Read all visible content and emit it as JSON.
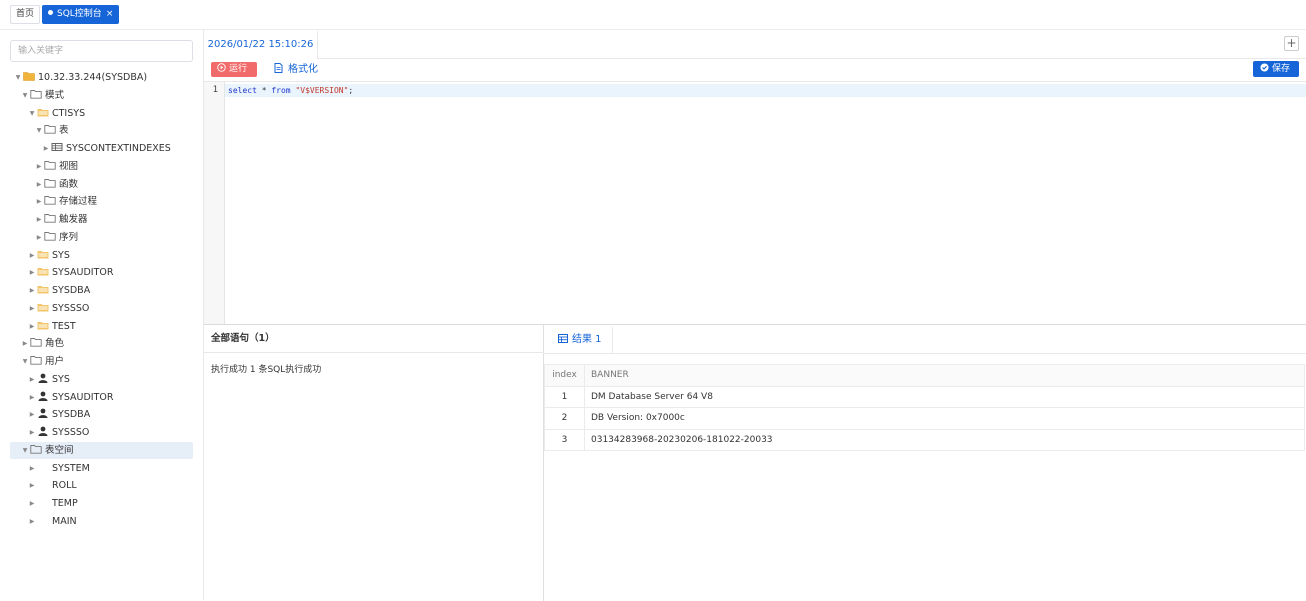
{
  "top_tabs": [
    {
      "label": "首页"
    },
    {
      "label": "SQL控制台",
      "close": "×"
    }
  ],
  "sidebar": {
    "search_placeholder": "输入关键字",
    "tree": [
      {
        "label": "10.32.33.244(SYSDBA)",
        "icon": "db-folder-icon"
      },
      {
        "label": "模式",
        "icon": "folder-icon"
      },
      {
        "label": "CTISYS",
        "icon": "schema-icon"
      },
      {
        "label": "表",
        "icon": "folder-icon"
      },
      {
        "label": "SYSCONTEXTINDEXES",
        "icon": "table-icon"
      },
      {
        "label": "视图",
        "icon": "folder-icon"
      },
      {
        "label": "函数",
        "icon": "folder-icon"
      },
      {
        "label": "存储过程",
        "icon": "folder-icon"
      },
      {
        "label": "触发器",
        "icon": "folder-icon"
      },
      {
        "label": "序列",
        "icon": "folder-icon"
      },
      {
        "label": "SYS",
        "icon": "schema-icon"
      },
      {
        "label": "SYSAUDITOR",
        "icon": "schema-icon"
      },
      {
        "label": "SYSDBA",
        "icon": "schema-icon"
      },
      {
        "label": "SYSSSO",
        "icon": "schema-icon"
      },
      {
        "label": "TEST",
        "icon": "schema-icon"
      },
      {
        "label": "角色",
        "icon": "folder-icon"
      },
      {
        "label": "用户",
        "icon": "folder-icon"
      },
      {
        "label": "SYS",
        "icon": "user-icon"
      },
      {
        "label": "SYSAUDITOR",
        "icon": "user-icon"
      },
      {
        "label": "SYSDBA",
        "icon": "user-icon"
      },
      {
        "label": "SYSSSO",
        "icon": "user-icon"
      },
      {
        "label": "表空间",
        "icon": "folder-icon"
      },
      {
        "label": "SYSTEM"
      },
      {
        "label": "ROLL"
      },
      {
        "label": "TEMP"
      },
      {
        "label": "MAIN"
      }
    ]
  },
  "editor": {
    "tab_label": "2026/01/22 15:10:26",
    "add_tab": "+",
    "run_label": "运行",
    "format_label": "格式化",
    "save_label": "保存",
    "line_number": "1",
    "code": {
      "kw1": "select",
      "star": " * ",
      "kw2": "from",
      "str": " \"V$VERSION\"",
      "end": ";"
    }
  },
  "statements": {
    "header": "全部语句（1）",
    "message": "执行成功 1 条SQL执行成功"
  },
  "results": {
    "tab_label": "结果 1",
    "columns": [
      "index",
      "BANNER"
    ],
    "rows": [
      [
        "1",
        "DM Database Server 64 V8"
      ],
      [
        "2",
        "DB Version: 0x7000c"
      ],
      [
        "3",
        "03134283968-20230206-181022-20033"
      ]
    ]
  },
  "colors": {
    "primary": "#1665d8",
    "run": "#f26b6b",
    "selected_row": "#e6eef8"
  }
}
